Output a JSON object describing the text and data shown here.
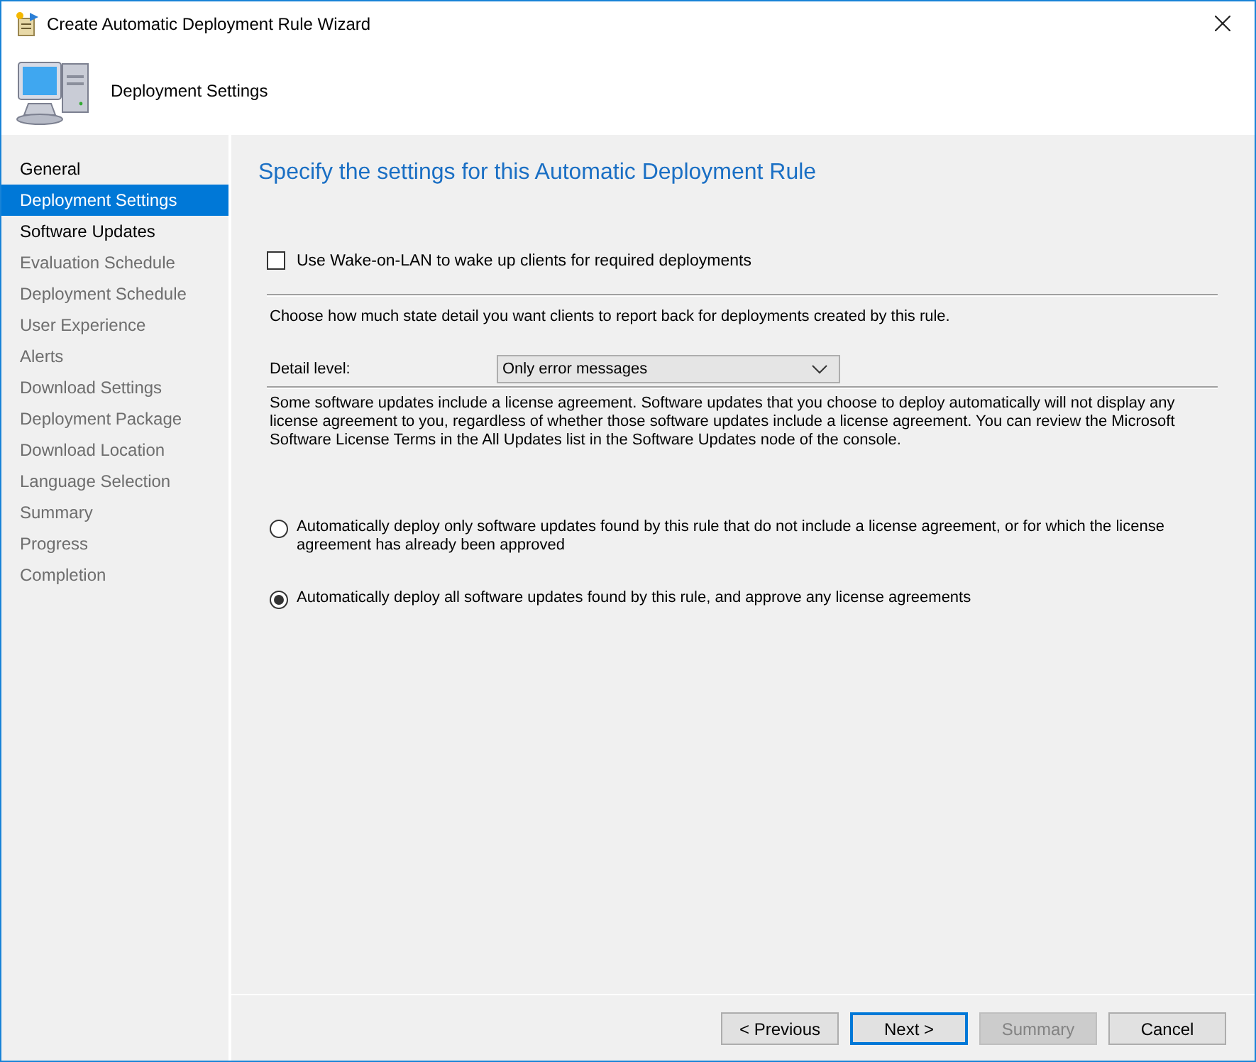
{
  "window": {
    "title": "Create Automatic Deployment Rule Wizard"
  },
  "header": {
    "title": "Deployment Settings"
  },
  "sidebar": {
    "items": [
      {
        "label": "General",
        "selected": false,
        "disabled": false
      },
      {
        "label": "Deployment Settings",
        "selected": true,
        "disabled": false
      },
      {
        "label": "Software Updates",
        "selected": false,
        "disabled": false
      },
      {
        "label": "Evaluation Schedule",
        "selected": false,
        "disabled": true
      },
      {
        "label": "Deployment Schedule",
        "selected": false,
        "disabled": true
      },
      {
        "label": "User Experience",
        "selected": false,
        "disabled": true
      },
      {
        "label": "Alerts",
        "selected": false,
        "disabled": true
      },
      {
        "label": "Download Settings",
        "selected": false,
        "disabled": true
      },
      {
        "label": "Deployment Package",
        "selected": false,
        "disabled": true
      },
      {
        "label": "Download Location",
        "selected": false,
        "disabled": true
      },
      {
        "label": "Language Selection",
        "selected": false,
        "disabled": true
      },
      {
        "label": "Summary",
        "selected": false,
        "disabled": true
      },
      {
        "label": "Progress",
        "selected": false,
        "disabled": true
      },
      {
        "label": "Completion",
        "selected": false,
        "disabled": true
      }
    ]
  },
  "content": {
    "heading": "Specify the settings for this Automatic Deployment Rule",
    "wake_on_lan": {
      "label": "Use Wake-on-LAN to wake up clients for required deployments",
      "checked": false
    },
    "state_detail_text": "Choose how much state detail you want clients to report back for deployments created by this rule.",
    "detail_level": {
      "label": "Detail level:",
      "value": "Only error messages"
    },
    "license_text": "Some software updates include a license agreement. Software updates that you choose to deploy automatically will not display any license agreement to you, regardless of whether those software updates include a license agreement. You can review the Microsoft Software License Terms in the All Updates list in the Software Updates node of the console.",
    "license_options": [
      {
        "label": "Automatically deploy only software updates found by this rule that do not include a license agreement, or for which the license agreement has already been approved",
        "selected": false
      },
      {
        "label": "Automatically deploy all software updates found by this rule, and approve any license agreements",
        "selected": true
      }
    ]
  },
  "buttons": [
    {
      "label": "< Previous",
      "disabled": false,
      "default": false
    },
    {
      "label": "Next >",
      "disabled": false,
      "default": true
    },
    {
      "label": "Summary",
      "disabled": true,
      "default": false
    },
    {
      "label": "Cancel",
      "disabled": false,
      "default": false
    }
  ]
}
